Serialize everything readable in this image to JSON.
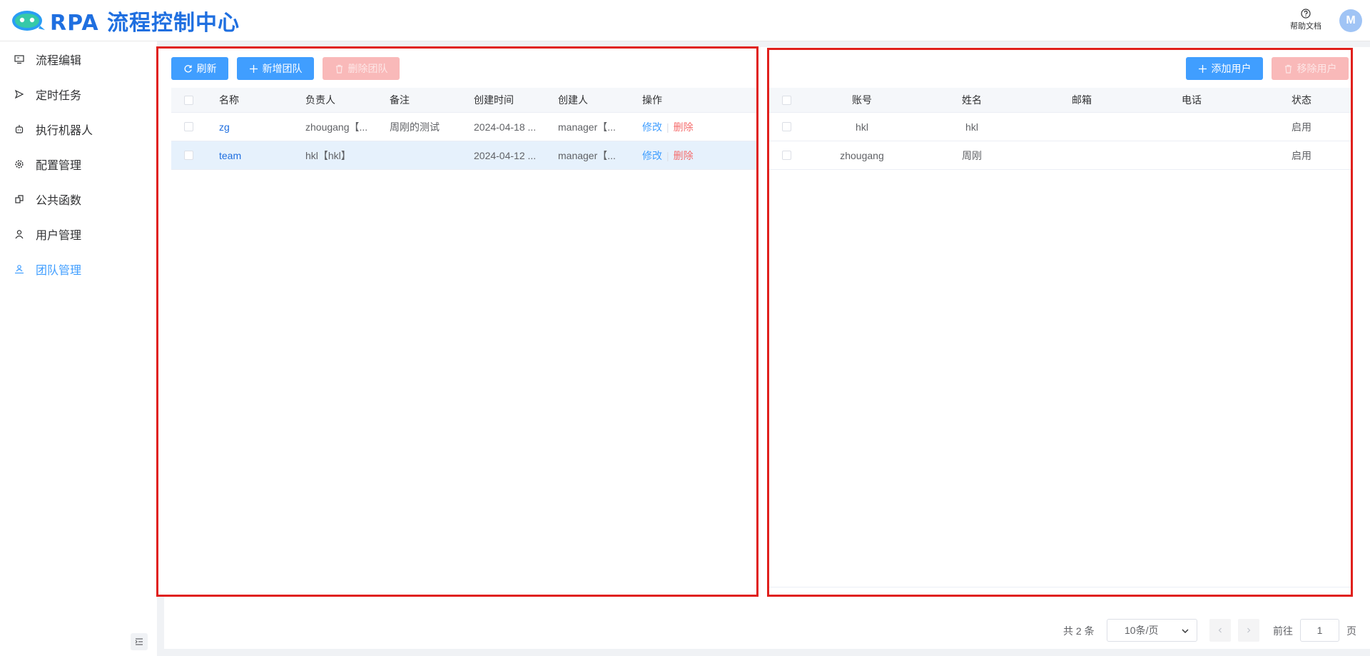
{
  "app": {
    "logo_text": "RPA 流程控制中心",
    "help_label": "帮助文档",
    "avatar_initial": "M"
  },
  "sidebar": {
    "items": [
      {
        "label": "流程编辑",
        "icon": "monitor-icon"
      },
      {
        "label": "定时任务",
        "icon": "send-icon"
      },
      {
        "label": "执行机器人",
        "icon": "robot-icon"
      },
      {
        "label": "配置管理",
        "icon": "gear-icon"
      },
      {
        "label": "公共函数",
        "icon": "copy-icon"
      },
      {
        "label": "用户管理",
        "icon": "user-icon"
      },
      {
        "label": "团队管理",
        "icon": "team-icon"
      }
    ],
    "active_index": 6
  },
  "team_panel": {
    "buttons": {
      "refresh": "刷新",
      "add_team": "新增团队",
      "delete_team": "删除团队"
    },
    "columns": [
      "名称",
      "负责人",
      "备注",
      "创建时间",
      "创建人",
      "操作"
    ],
    "rows": [
      {
        "name": "zg",
        "owner": "zhougang【...",
        "remark": "周刚的测试",
        "created": "2024-04-18 ...",
        "creator": "manager【...",
        "edit": "修改",
        "delete": "删除"
      },
      {
        "name": "team",
        "owner": "hkl【hkl】",
        "remark": "",
        "created": "2024-04-12 ...",
        "creator": "manager【...",
        "edit": "修改",
        "delete": "删除"
      }
    ]
  },
  "user_panel": {
    "buttons": {
      "add_user": "添加用户",
      "remove_user": "移除用户"
    },
    "columns": [
      "账号",
      "姓名",
      "邮箱",
      "电话",
      "状态"
    ],
    "rows": [
      {
        "account": "hkl",
        "name": "hkl",
        "email": "",
        "phone": "",
        "status": "启用"
      },
      {
        "account": "zhougang",
        "name": "周刚",
        "email": "",
        "phone": "",
        "status": "启用"
      }
    ]
  },
  "pagination": {
    "total": "共 2 条",
    "page_size": "10条/页",
    "goto_label": "前往",
    "current_page": "1",
    "page_unit": "页"
  },
  "colors": {
    "primary": "#409eff",
    "danger": "#f56c6c",
    "highlight_border": "#e0201c"
  }
}
